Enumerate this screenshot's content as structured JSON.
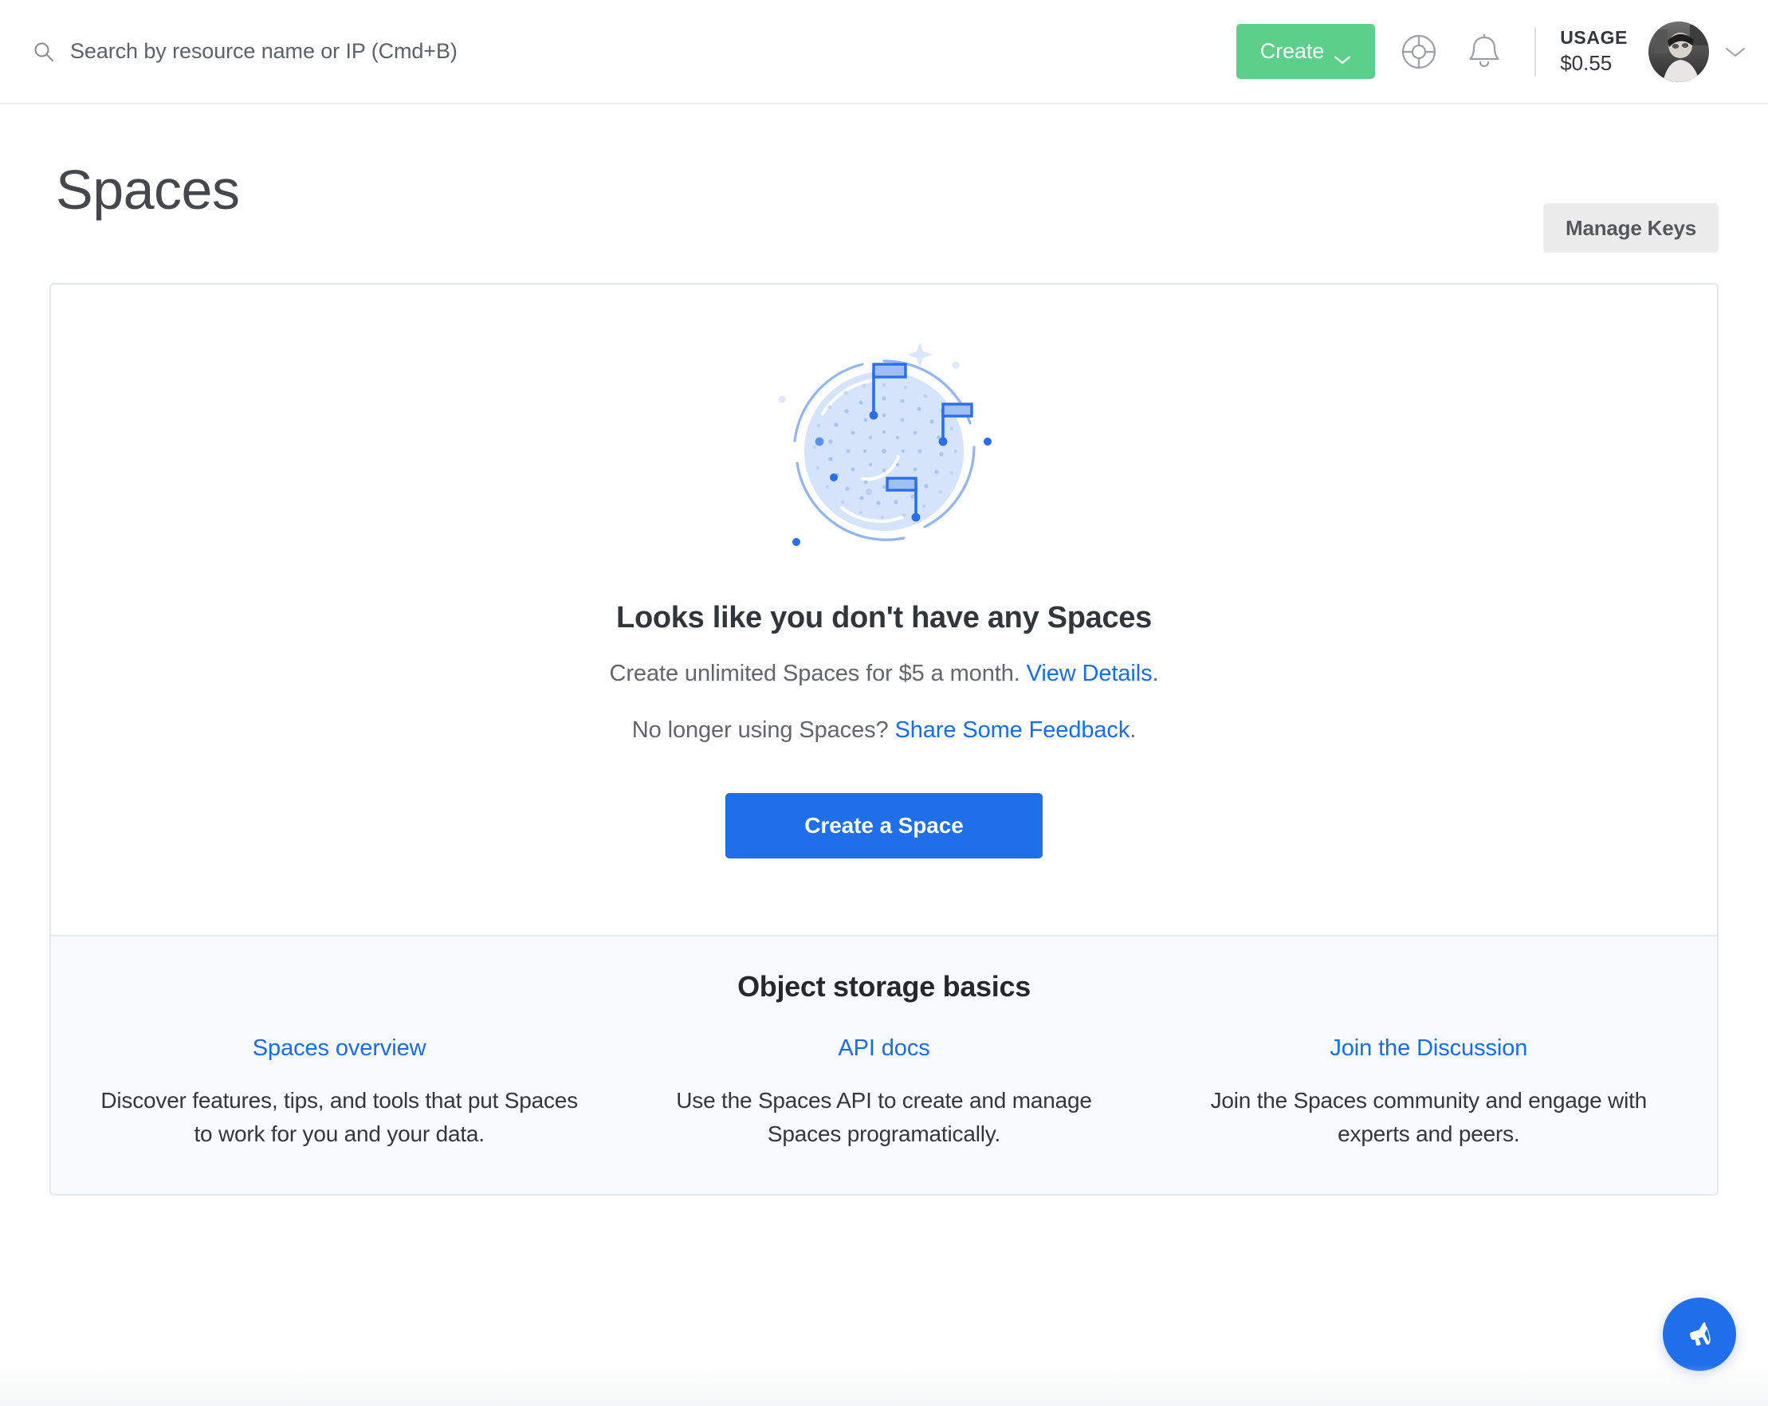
{
  "header": {
    "search": {
      "placeholder": "Search by resource name or IP (Cmd+B)",
      "value": "",
      "icon": "search-icon"
    },
    "create_label": "Create",
    "support_icon": "lifebuoy-icon",
    "notifications_icon": "bell-icon",
    "usage_label": "USAGE",
    "usage_value": "$0.55",
    "avatar_icon": "user-avatar",
    "profile_chevron_icon": "chevron-down-icon"
  },
  "page": {
    "title": "Spaces",
    "manage_keys_label": "Manage Keys"
  },
  "empty_state": {
    "illustration_icon": "radar-flags-illustration",
    "headline": "Looks like you don't have any Spaces",
    "sub_prefix": "Create unlimited Spaces for $5 a month. ",
    "sub_link": "View Details",
    "sub_suffix": ".",
    "sub2_prefix": "No longer using Spaces? ",
    "sub2_link": "Share Some Feedback",
    "sub2_suffix": ".",
    "cta_label": "Create a Space"
  },
  "basics": {
    "title": "Object storage basics",
    "columns": [
      {
        "link": "Spaces overview",
        "desc": "Discover features, tips, and tools that put Spaces to work for you and your data."
      },
      {
        "link": "API docs",
        "desc": "Use the Spaces API to create and manage Spaces programatically."
      },
      {
        "link": "Join the Discussion",
        "desc": "Join the Spaces community and engage with experts and peers."
      }
    ]
  },
  "feedback_button": {
    "icon": "megaphone-icon"
  },
  "colors": {
    "accent_blue": "#1f6feb",
    "link_blue": "#176cf0",
    "create_green": "#5cd08a",
    "basics_bg": "#f7fbfd",
    "card_border": "#e5e8ea",
    "text_dark": "#31363b",
    "text_muted": "#60666c"
  }
}
